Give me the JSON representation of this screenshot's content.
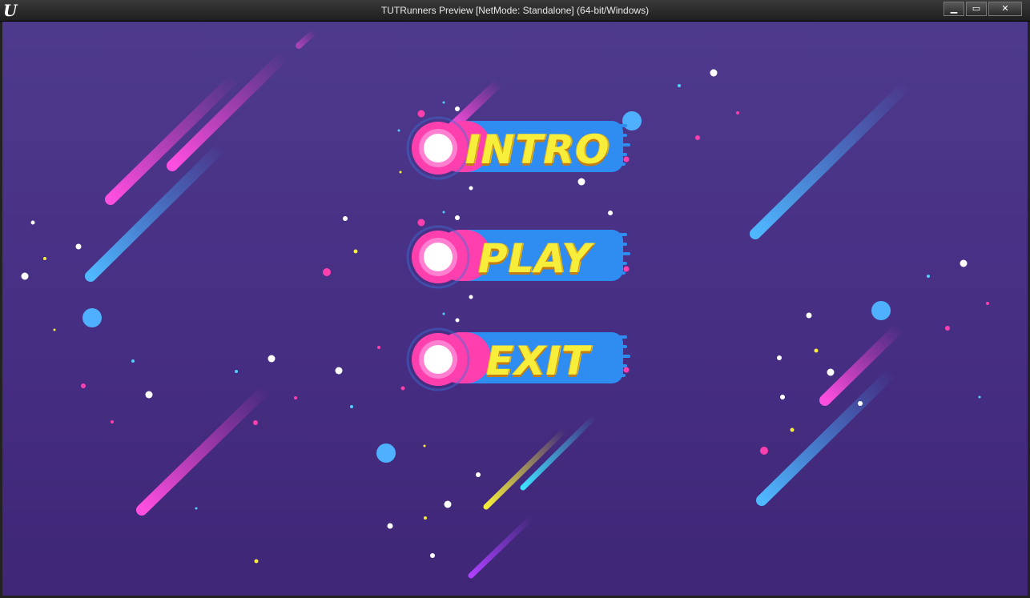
{
  "window": {
    "title": "TUTRunners Preview [NetMode: Standalone]  (64-bit/Windows)",
    "logo_icon": "unreal-engine-logo-icon",
    "buttons": {
      "minimize": "▁",
      "maximize": "▭",
      "close": "✕"
    }
  },
  "menu": {
    "items": [
      {
        "label": "INTRO"
      },
      {
        "label": "PLAY"
      },
      {
        "label": "EXIT"
      }
    ]
  },
  "colors": {
    "background": "#472f84",
    "button_blue": "#2f8cf0",
    "button_pink": "#ff3fae",
    "label_yellow": "#f6ee3a",
    "streak_pink": "#ff3fd0",
    "streak_blue": "#3fa8ff"
  }
}
